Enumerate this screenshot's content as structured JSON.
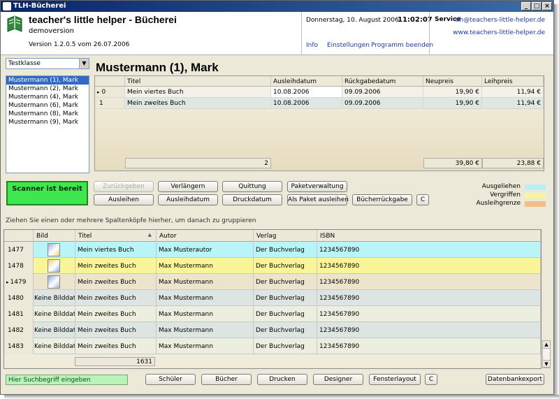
{
  "window": {
    "title": "TLH-Bücherei",
    "controls": [
      "_",
      "□",
      "×"
    ]
  },
  "header": {
    "app_title": "teacher's little helper - Bücherei",
    "edition": "demoversion",
    "version": "Version 1.2.0.5 vom 26.07.2006",
    "date": "Donnerstag, 10. August 2006",
    "time": "11:02:07",
    "links": [
      "Info",
      "Einstellungen",
      "Programm beenden"
    ],
    "service_label": "Service",
    "email": "tlh@teachers-little-helper.de",
    "website": "www.teachers-little-helper.de"
  },
  "sidebar": {
    "class_select": "Testklasse",
    "students": [
      "Mustermann (1), Mark",
      "Mustermann (2), Mark",
      "Mustermann (4), Mark",
      "Mustermann (6), Mark",
      "Mustermann (8), Mark",
      "Mustermann (9), Mark"
    ],
    "selected_index": 0
  },
  "loans": {
    "student_name": "Mustermann (1), Mark",
    "columns": [
      "",
      "Titel",
      "Ausleihdatum",
      "Rückgabedatum",
      "Neupreis",
      "Leihpreis"
    ],
    "rows": [
      {
        "index": "0",
        "marker": "▸",
        "title": "Mein viertes Buch",
        "loan_date": "10.08.2006",
        "return_date": "09.09.2006",
        "new_price": "19,90 €",
        "loan_price": "11,94 €"
      },
      {
        "index": "1",
        "marker": "",
        "title": "Mein zweites Buch",
        "loan_date": "10.08.2006",
        "return_date": "09.09.2006",
        "new_price": "19,90 €",
        "loan_price": "11,94 €"
      }
    ],
    "footer": {
      "count": "2",
      "new_total": "39,80 €",
      "loan_total": "23,88 €"
    }
  },
  "actions": {
    "scanner_status": "Scanner ist bereit",
    "buttons": {
      "return": "Zurückgeben",
      "lend": "Ausleihen",
      "extend": "Verlängern",
      "loan_date": "Ausleihdatum",
      "receipt": "Quittung",
      "print_date": "Druckdatum",
      "package_admin": "Paketverwaltung",
      "lend_package": "Als Paket ausleihen",
      "book_return": "Bücherrückgabe",
      "clear": "C"
    }
  },
  "legend": [
    {
      "label": "Ausgeliehen",
      "color": "#b8f0f8"
    },
    {
      "label": "Vergriffen",
      "color": "#fbf59a"
    },
    {
      "label": "Ausleihgrenze",
      "color": "#f3bd8a"
    }
  ],
  "books": {
    "group_hint": "Ziehen Sie einen oder mehrere Spaltenköpfe hierher, um danach zu gruppieren",
    "columns": [
      "",
      "Bild",
      "Titel",
      "Autor",
      "Verlag",
      "ISBN"
    ],
    "sort_indicator": "▲",
    "rows": [
      {
        "id": "1477",
        "marker": "",
        "image": "",
        "has_image": true,
        "title": "Mein viertes Buch",
        "author": "Max Musterautor",
        "publisher": "Der Buchverlag",
        "isbn": "1234567890",
        "color": "#b8f4f8"
      },
      {
        "id": "1478",
        "marker": "",
        "image": "",
        "has_image": true,
        "title": "Mein zweites Buch",
        "author": "Max Mustermann",
        "publisher": "Der Buchverlag",
        "isbn": "1234567890",
        "color": "#fbf59a"
      },
      {
        "id": "1479",
        "marker": "▸",
        "image": "",
        "has_image": true,
        "title": "Mein zweites Buch",
        "author": "Max Mustermann",
        "publisher": "Der Buchverlag",
        "isbn": "1234567890",
        "color": "#ece5cb"
      },
      {
        "id": "1480",
        "marker": "",
        "image": "Keine Bilddaten",
        "has_image": false,
        "title": "Mein zweites Buch",
        "author": "Max Mustermann",
        "publisher": "Der Buchverlag",
        "isbn": "1234567890",
        "color": "#dde5e3"
      },
      {
        "id": "1481",
        "marker": "",
        "image": "Keine Bilddaten",
        "has_image": false,
        "title": "Mein zweites Buch",
        "author": "Max Mustermann",
        "publisher": "Der Buchverlag",
        "isbn": "1234567890",
        "color": "#eceee0"
      },
      {
        "id": "1482",
        "marker": "",
        "image": "Keine Bilddaten",
        "has_image": false,
        "title": "Mein zweites Buch",
        "author": "Max Mustermann",
        "publisher": "Der Buchverlag",
        "isbn": "1234567890",
        "color": "#dde5e3"
      },
      {
        "id": "1483",
        "marker": "",
        "image": "Keine Bilddaten",
        "has_image": false,
        "title": "Mein zweites Buch",
        "author": "Max Mustermann",
        "publisher": "Der Buchverlag",
        "isbn": "1234567890",
        "color": "#eceee0"
      }
    ],
    "total_count": "1631"
  },
  "footer": {
    "search_placeholder": "Hier Suchbegriff eingeben",
    "buttons": [
      "Schüler",
      "Bücher",
      "Drucken",
      "Designer",
      "Fensterlayout",
      "C",
      "Datenbankexport"
    ]
  }
}
